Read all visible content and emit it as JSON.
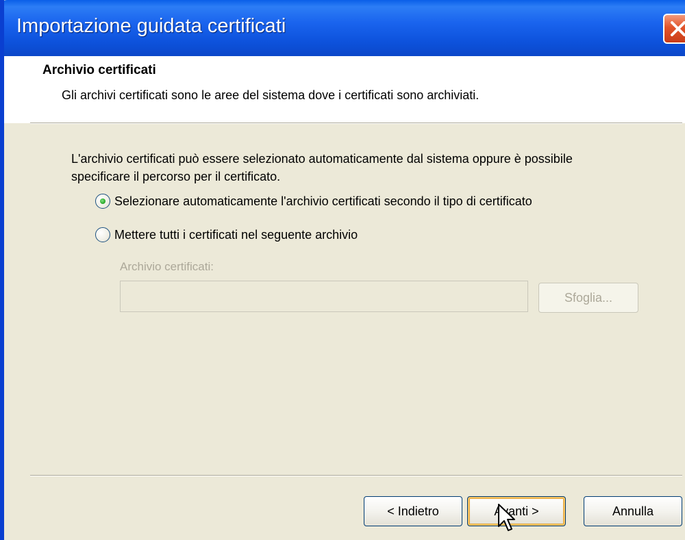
{
  "window": {
    "title": "Importazione guidata certificati"
  },
  "header": {
    "title": "Archivio certificati",
    "subtitle": "Gli archivi certificati sono le aree del sistema dove i certificati sono archiviati."
  },
  "body": {
    "description": "L'archivio certificati può essere selezionato automaticamente dal sistema oppure è possibile specificare il percorso per il certificato."
  },
  "options": [
    {
      "label": "Selezionare automaticamente l'archivio certificati secondo il tipo di certificato",
      "selected": true
    },
    {
      "label": "Mettere tutti i certificati nel seguente archivio",
      "selected": false
    }
  ],
  "store_field": {
    "label": "Archivio certificati:",
    "value": "",
    "enabled": false
  },
  "browse_button": {
    "label": "Sfoglia...",
    "enabled": false
  },
  "footer": {
    "back_label": "< Indietro",
    "next_label": "Avanti >",
    "cancel_label": "Annulla"
  },
  "colors": {
    "titlebar": "#0d52dc",
    "window_bg": "#ece9d8",
    "close_button": "#e2542a",
    "radio_dot": "#21a121",
    "default_button_highlight": "#f7c565"
  },
  "icons": {
    "close": "close-icon",
    "cursor": "mouse-pointer-icon"
  }
}
